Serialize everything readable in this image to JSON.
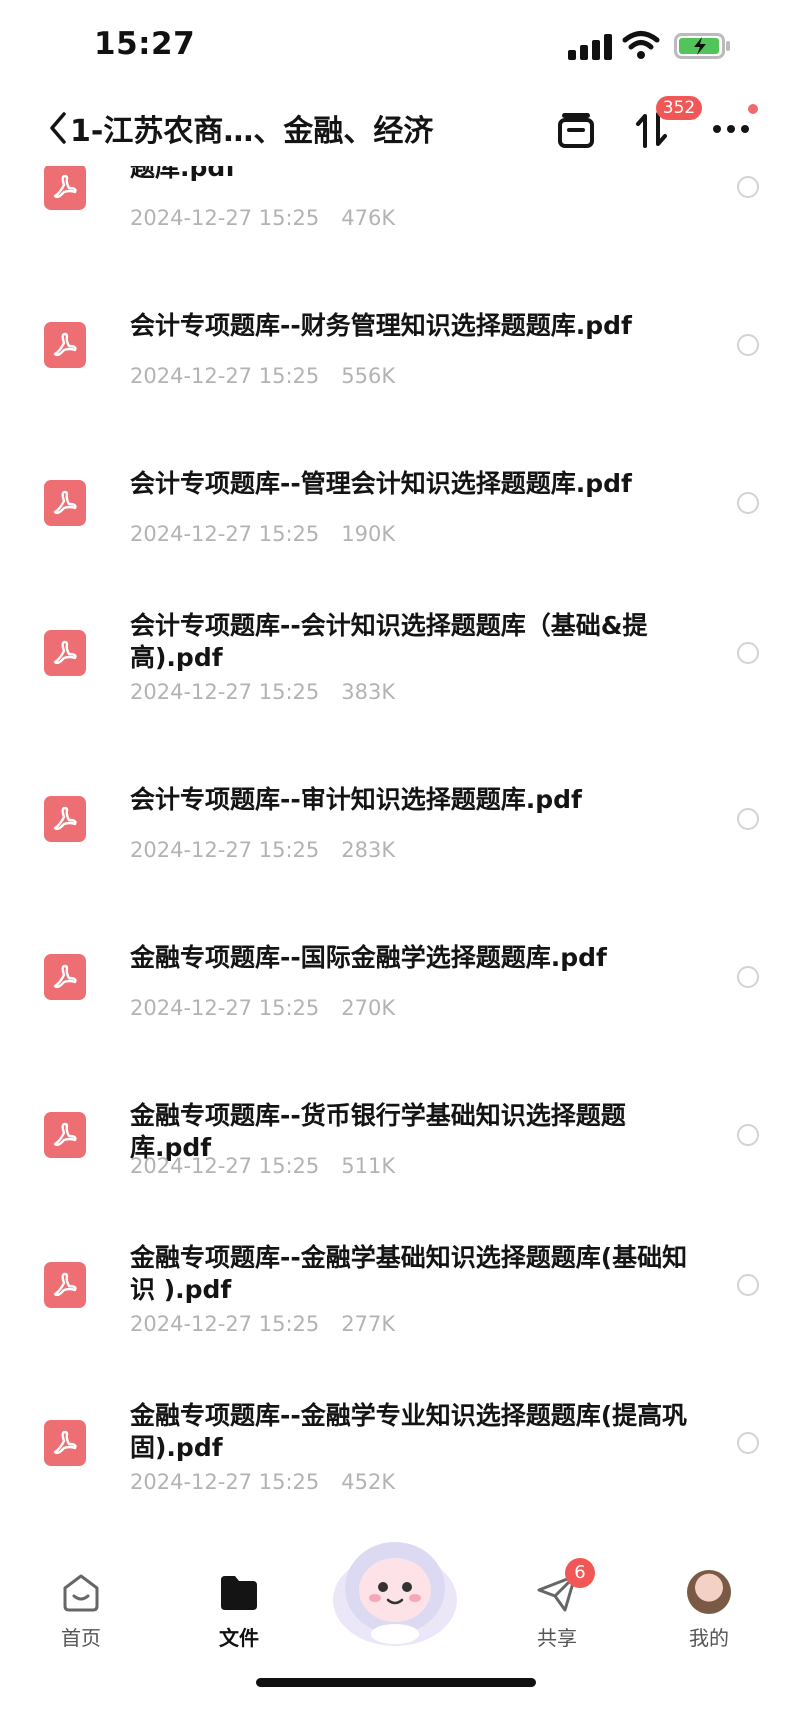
{
  "status_bar": {
    "time": "15:27"
  },
  "header": {
    "title": "1-江苏农商…、金融、经济",
    "transfer_badge": "352"
  },
  "files": [
    {
      "name": "题库.pdf",
      "date": "2024-12-27 15:25",
      "size": "476K"
    },
    {
      "name": "会计专项题库--财务管理知识选择题题库.pdf",
      "date": "2024-12-27 15:25",
      "size": "556K"
    },
    {
      "name": "会计专项题库--管理会计知识选择题题库.pdf",
      "date": "2024-12-27 15:25",
      "size": "190K"
    },
    {
      "name": "会计专项题库--会计知识选择题题库（基础&提高).pdf",
      "date": "2024-12-27 15:25",
      "size": "383K"
    },
    {
      "name": "会计专项题库--审计知识选择题题库.pdf",
      "date": "2024-12-27 15:25",
      "size": "283K"
    },
    {
      "name": "金融专项题库--国际金融学选择题题库.pdf",
      "date": "2024-12-27 15:25",
      "size": "270K"
    },
    {
      "name": "金融专项题库--货币银行学基础知识选择题题库.pdf",
      "date": "2024-12-27 15:25",
      "size": "511K"
    },
    {
      "name": "金融专项题库--金融学基础知识选择题题库(基础知识 ).pdf",
      "date": "2024-12-27 15:25",
      "size": "277K"
    },
    {
      "name": "金融专项题库--金融学专业知识选择题题库(提高巩固).pdf",
      "date": "2024-12-27 15:25",
      "size": "452K"
    }
  ],
  "tab_bar": {
    "home": "首页",
    "files": "文件",
    "share": "共享",
    "share_badge": "6",
    "me": "我的"
  },
  "colors": {
    "pdf_icon": "#ee6f73",
    "badge": "#f25757",
    "meta_text": "#b3b3b3"
  },
  "icons": {
    "back": "chevron-left-icon",
    "box": "box-icon",
    "transfer": "transfer-icon",
    "more": "more-icon",
    "pdf": "pdf-icon",
    "home": "home-icon",
    "files": "folder-icon",
    "share": "paper-plane-icon"
  }
}
